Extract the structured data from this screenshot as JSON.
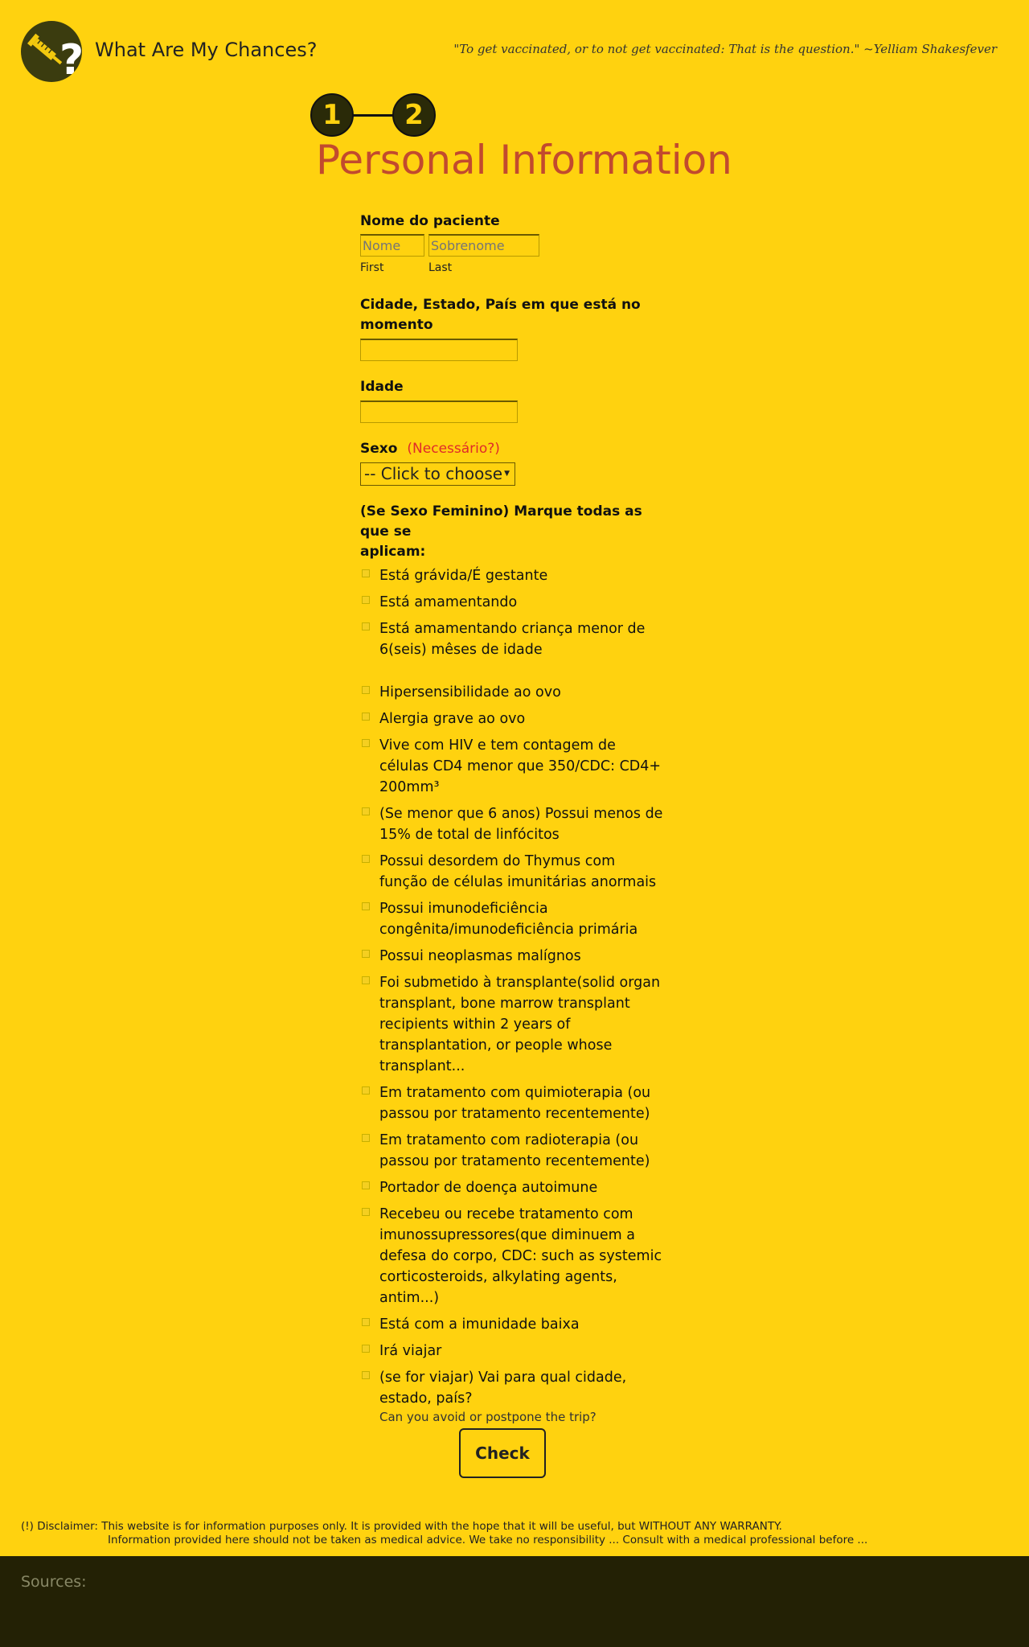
{
  "header": {
    "brand_name": "What Are My Chances?",
    "quote": "\"To get vaccinated, or to not get vaccinated: That is the question.\" ~Yelliam Shakesfever",
    "logo_icon": "syringe-question-icon"
  },
  "steps": [
    "1",
    "2"
  ],
  "page_title": "Personal Information",
  "form": {
    "patient_name": {
      "label": "Nome do paciente",
      "first_placeholder": "Nome",
      "last_placeholder": "Sobrenome",
      "first_sublabel": "First",
      "last_sublabel": "Last"
    },
    "location": {
      "label_line1": "Cidade, Estado, País em que está no",
      "label_line2": "momento",
      "value": ""
    },
    "age": {
      "label": "Idade",
      "value": ""
    },
    "sex": {
      "label": "Sexo",
      "required_text": "(Necessário?)",
      "select_value": "-- Click to choose"
    },
    "conditions": {
      "label_line1": "(Se Sexo Feminino) Marque todas as que se",
      "label_line2": "aplicam:",
      "female_items": [
        "Está grávida/É gestante",
        "Está amamentando",
        "Está amamentando criança menor de 6(seis) mêses de idade"
      ],
      "items": [
        "Hipersensibilidade ao ovo",
        "Alergia grave ao ovo",
        "Vive com HIV e tem contagem de células CD4 menor que 350/CDC: CD4+ 200mm³",
        "(Se menor que 6 anos) Possui menos de 15% de total de linfócitos",
        "Possui desordem do Thymus com função de células imunitárias anormais",
        "Possui imunodeficiência congênita/imunodeficiência primária",
        "Possui neoplasmas malígnos",
        "Foi submetido à transplante(solid organ transplant, bone marrow transplant recipients within 2 years of transplantation, or people whose transplant...",
        "Em tratamento com quimioterapia (ou passou por tratamento recentemente)",
        "Em tratamento com radioterapia (ou passou por tratamento recentemente)",
        "Portador de doença autoimune",
        "Recebeu ou recebe tratamento com imunossupressores(que diminuem a defesa do corpo, CDC: such as systemic corticosteroids, alkylating agents, antim...)",
        "Está com a imunidade baixa",
        "Irá viajar",
        "(se for viajar) Vai para qual cidade, estado, país?"
      ],
      "travel_hint": "Can you avoid or postpone the trip?"
    },
    "submit_label": "Check"
  },
  "disclaimer": {
    "line1": "(!) Disclaimer: This website is for information purposes only. It is provided with the hope that it will be useful, but WITHOUT ANY WARRANTY.",
    "line2": "Information provided here should not be taken as medical advice. We take no responsibility ... Consult with a medical professional before ..."
  },
  "footer": {
    "sources_label": "Sources:"
  },
  "colors": {
    "background": "#ffd20f",
    "title": "#c24a2e",
    "required": "#e02a2a",
    "footer": "#232105"
  }
}
